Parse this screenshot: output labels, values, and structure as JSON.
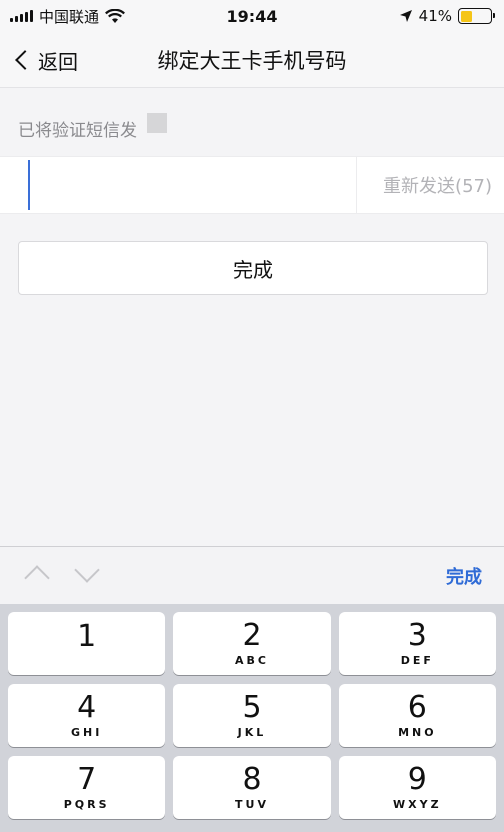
{
  "status_bar": {
    "carrier": "中国联通",
    "time": "19:44",
    "battery": "41%",
    "battery_level": 0.41
  },
  "nav": {
    "back_label": "返回",
    "title": "绑定大王卡手机号码"
  },
  "content": {
    "hint": "已将验证短信发",
    "code_input_value": "",
    "resend_label": "重新发送(57)",
    "done_button_label": "完成"
  },
  "accessory": {
    "done_label": "完成"
  },
  "keypad": {
    "keys": [
      {
        "num": "1",
        "letters": ""
      },
      {
        "num": "2",
        "letters": "ABC"
      },
      {
        "num": "3",
        "letters": "DEF"
      },
      {
        "num": "4",
        "letters": "GHI"
      },
      {
        "num": "5",
        "letters": "JKL"
      },
      {
        "num": "6",
        "letters": "MNO"
      },
      {
        "num": "7",
        "letters": "PQRS"
      },
      {
        "num": "8",
        "letters": "TUV"
      },
      {
        "num": "9",
        "letters": "WXYZ"
      }
    ]
  },
  "colors": {
    "accent": "#2f6bd6",
    "battery_fill": "#f5c518",
    "caret": "#3a6fd8"
  }
}
